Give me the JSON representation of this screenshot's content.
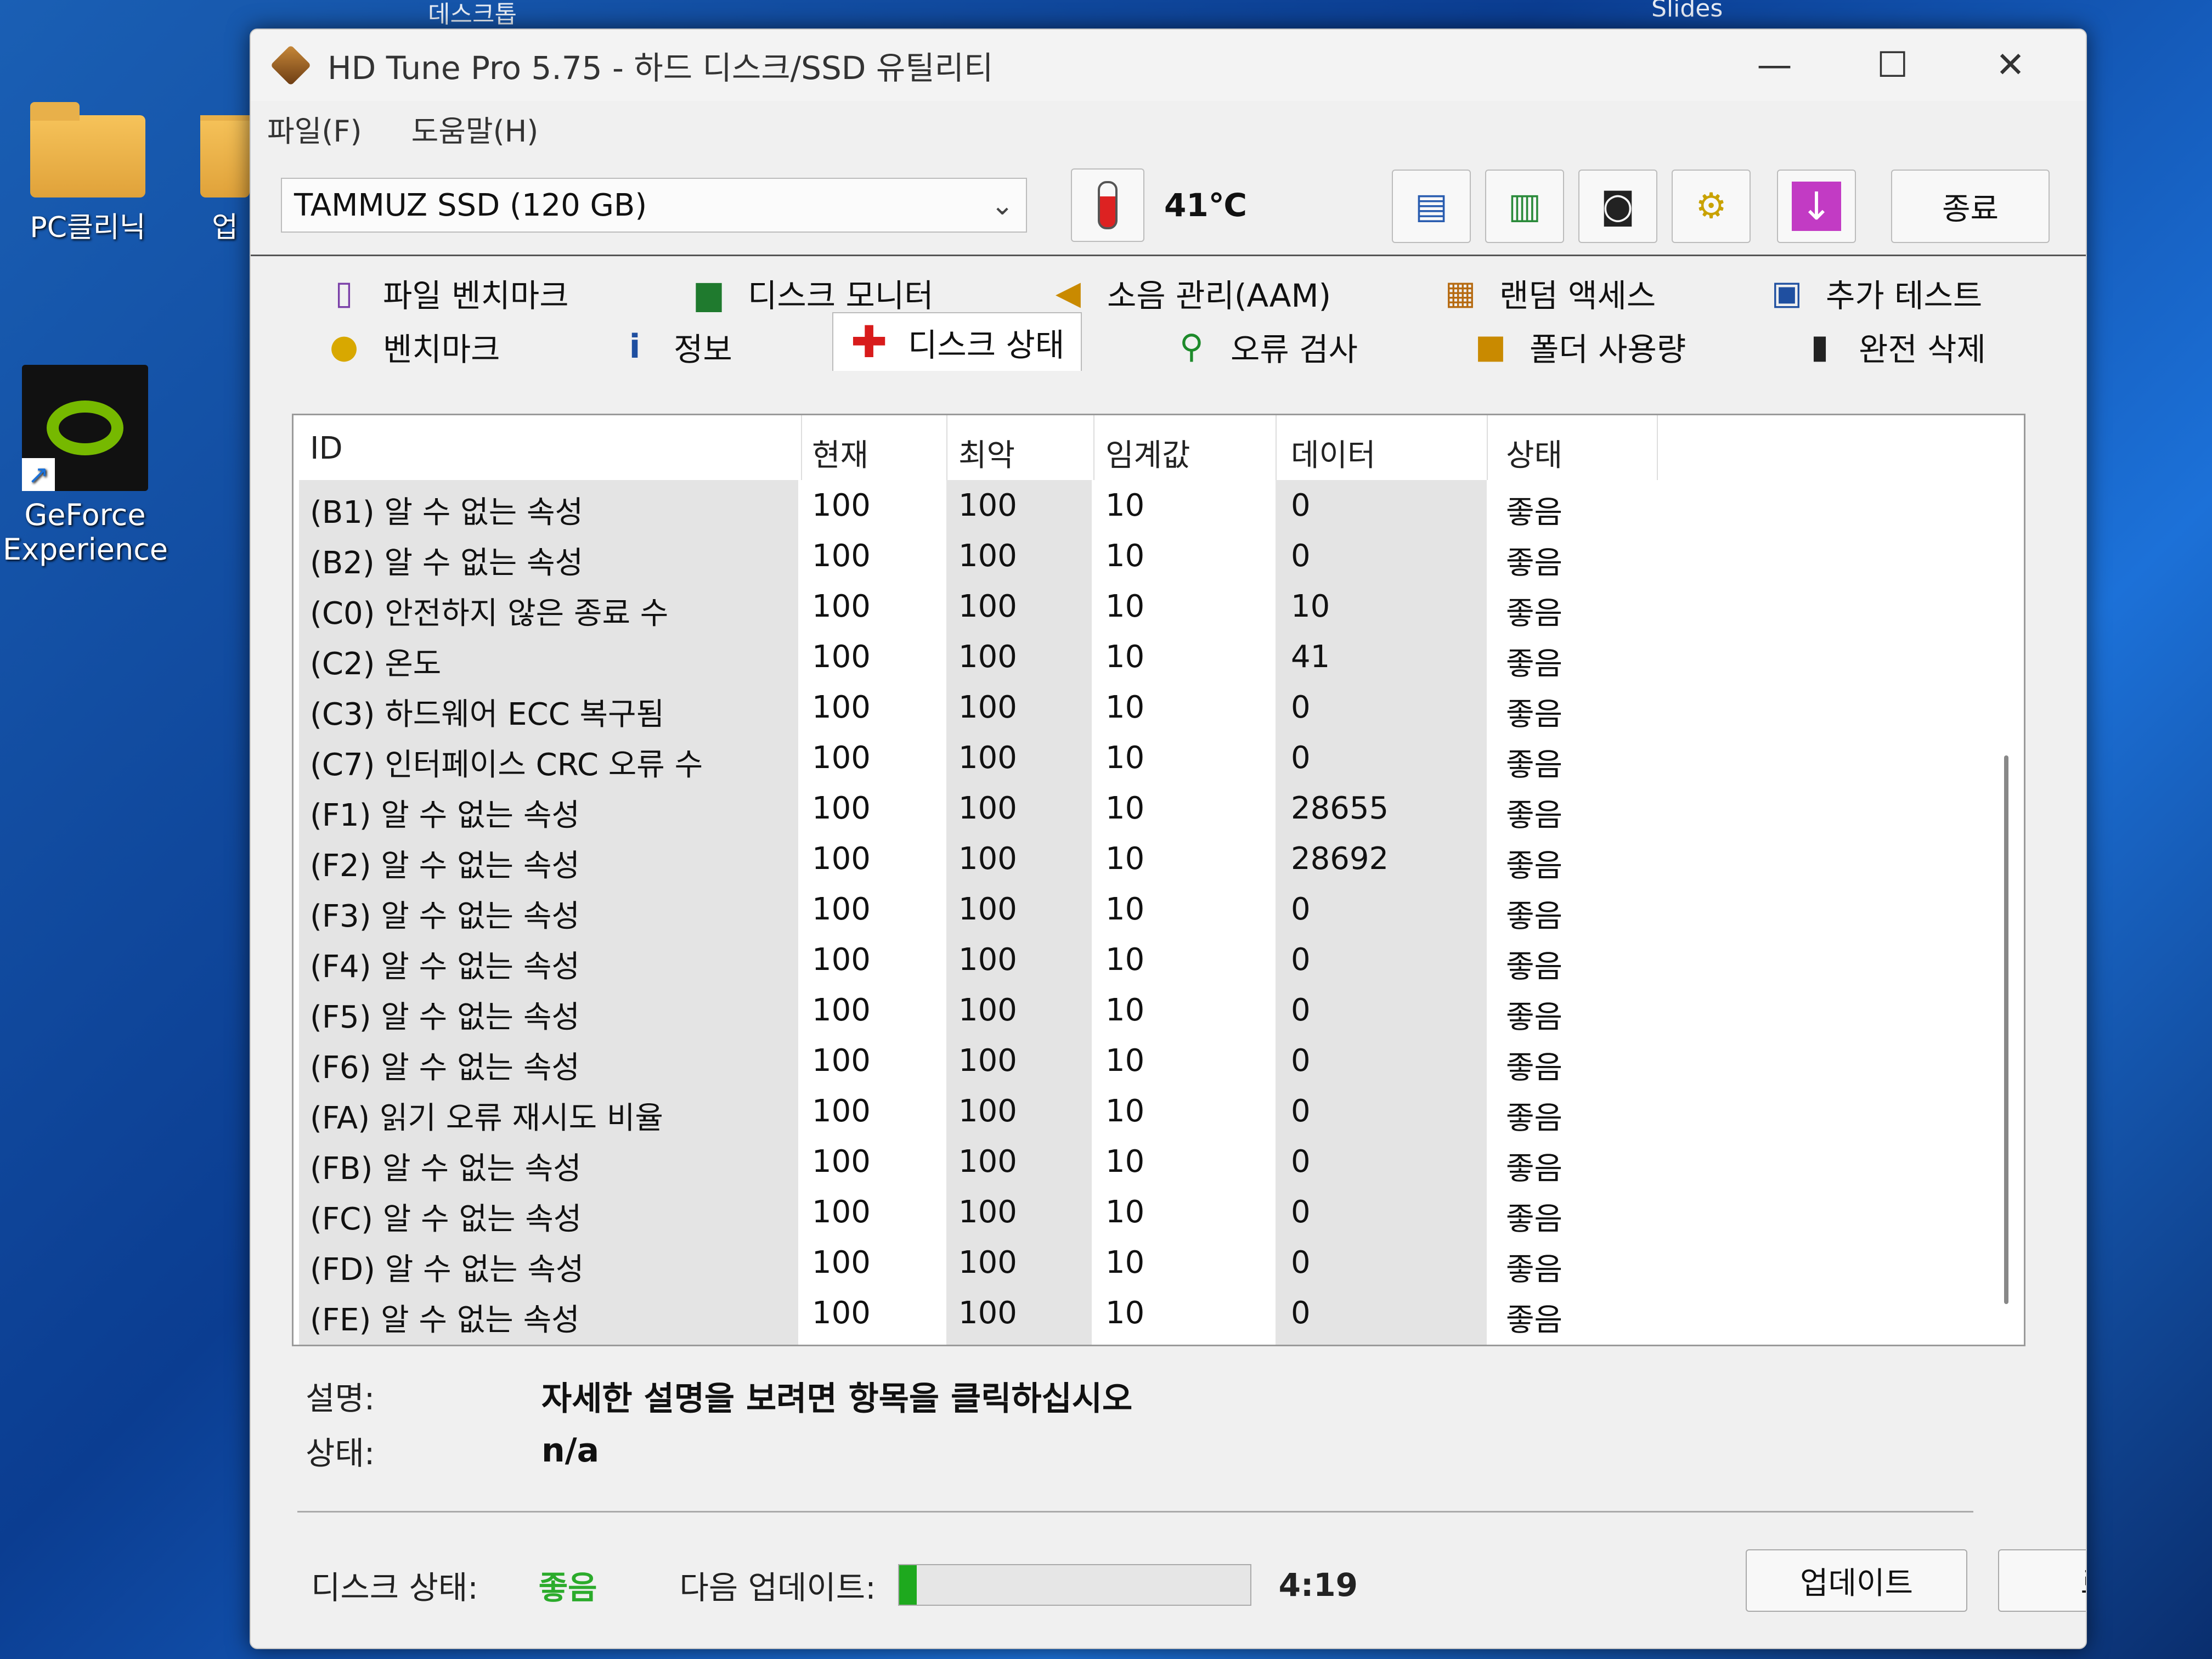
{
  "desktop": {
    "top_texts": [
      "데스크톱",
      "Slides"
    ],
    "icons": [
      {
        "label": "PC클리닉"
      },
      {
        "label": "업"
      },
      {
        "label_line1": "GeForce",
        "label_line2": "Experience"
      }
    ]
  },
  "window": {
    "title": "HD Tune Pro 5.75 - 하드 디스크/SSD 유틸리티",
    "controls": {
      "minimize": "—",
      "maximize": "☐",
      "close": "✕"
    }
  },
  "menu": {
    "items": [
      "파일(F)",
      "도움말(H)"
    ]
  },
  "toolbar": {
    "drive": "TAMMUZ SSD (120 GB)",
    "temperature": "41℃",
    "exit_label": "종료"
  },
  "tabs": {
    "row1": [
      {
        "label": "파일 벤치마크",
        "icon": "file-benchmark-icon"
      },
      {
        "label": "디스크 모니터",
        "icon": "disk-monitor-icon"
      },
      {
        "label": "소음 관리(AAM)",
        "icon": "speaker-icon"
      },
      {
        "label": "랜덤 액세스",
        "icon": "random-access-icon"
      },
      {
        "label": "추가 테스트",
        "icon": "extra-tests-icon"
      }
    ],
    "row2": [
      {
        "label": "벤치마크",
        "icon": "bulb-icon"
      },
      {
        "label": "정보",
        "icon": "info-icon"
      },
      {
        "label": "디스크 상태",
        "icon": "red-cross-icon"
      },
      {
        "label": "오류 검사",
        "icon": "magnifier-icon"
      },
      {
        "label": "폴더 사용량",
        "icon": "folder-icon"
      },
      {
        "label": "완전 삭제",
        "icon": "trash-icon"
      }
    ]
  },
  "table": {
    "headers": [
      "ID",
      "현재",
      "최악",
      "임계값",
      "데이터",
      "상태"
    ],
    "rows": [
      [
        "(B1) 알 수 없는 속성",
        "100",
        "100",
        "10",
        "0",
        "좋음"
      ],
      [
        "(B2) 알 수 없는 속성",
        "100",
        "100",
        "10",
        "0",
        "좋음"
      ],
      [
        "(C0) 안전하지 않은 종료 수",
        "100",
        "100",
        "10",
        "10",
        "좋음"
      ],
      [
        "(C2) 온도",
        "100",
        "100",
        "10",
        "41",
        "좋음"
      ],
      [
        "(C3) 하드웨어 ECC 복구됨",
        "100",
        "100",
        "10",
        "0",
        "좋음"
      ],
      [
        "(C7) 인터페이스 CRC 오류 수",
        "100",
        "100",
        "10",
        "0",
        "좋음"
      ],
      [
        "(F1) 알 수 없는 속성",
        "100",
        "100",
        "10",
        "28655",
        "좋음"
      ],
      [
        "(F2) 알 수 없는 속성",
        "100",
        "100",
        "10",
        "28692",
        "좋음"
      ],
      [
        "(F3) 알 수 없는 속성",
        "100",
        "100",
        "10",
        "0",
        "좋음"
      ],
      [
        "(F4) 알 수 없는 속성",
        "100",
        "100",
        "10",
        "0",
        "좋음"
      ],
      [
        "(F5) 알 수 없는 속성",
        "100",
        "100",
        "10",
        "0",
        "좋음"
      ],
      [
        "(F6) 알 수 없는 속성",
        "100",
        "100",
        "10",
        "0",
        "좋음"
      ],
      [
        "(FA) 읽기 오류 재시도 비율",
        "100",
        "100",
        "10",
        "0",
        "좋음"
      ],
      [
        "(FB) 알 수 없는 속성",
        "100",
        "100",
        "10",
        "0",
        "좋음"
      ],
      [
        "(FC) 알 수 없는 속성",
        "100",
        "100",
        "10",
        "0",
        "좋음"
      ],
      [
        "(FD) 알 수 없는 속성",
        "100",
        "100",
        "10",
        "0",
        "좋음"
      ],
      [
        "(FE) 알 수 없는 속성",
        "100",
        "100",
        "10",
        "0",
        "좋음"
      ]
    ]
  },
  "description": {
    "label": "설명:",
    "value": "자세한 설명을 보려면 항목을 클릭하십시오",
    "status_label": "상태:",
    "status_value": "n/a"
  },
  "statusbar": {
    "disk_status_label": "디스크 상태:",
    "disk_status_value": "좋음",
    "next_update_label": "다음 업데이트:",
    "progress_fraction": 0.05,
    "countdown": "4:19",
    "update_button": "업데이트",
    "log_button": "로그"
  },
  "colors": {
    "status_good": "#2bab2b",
    "progress": "#1ea91e"
  }
}
